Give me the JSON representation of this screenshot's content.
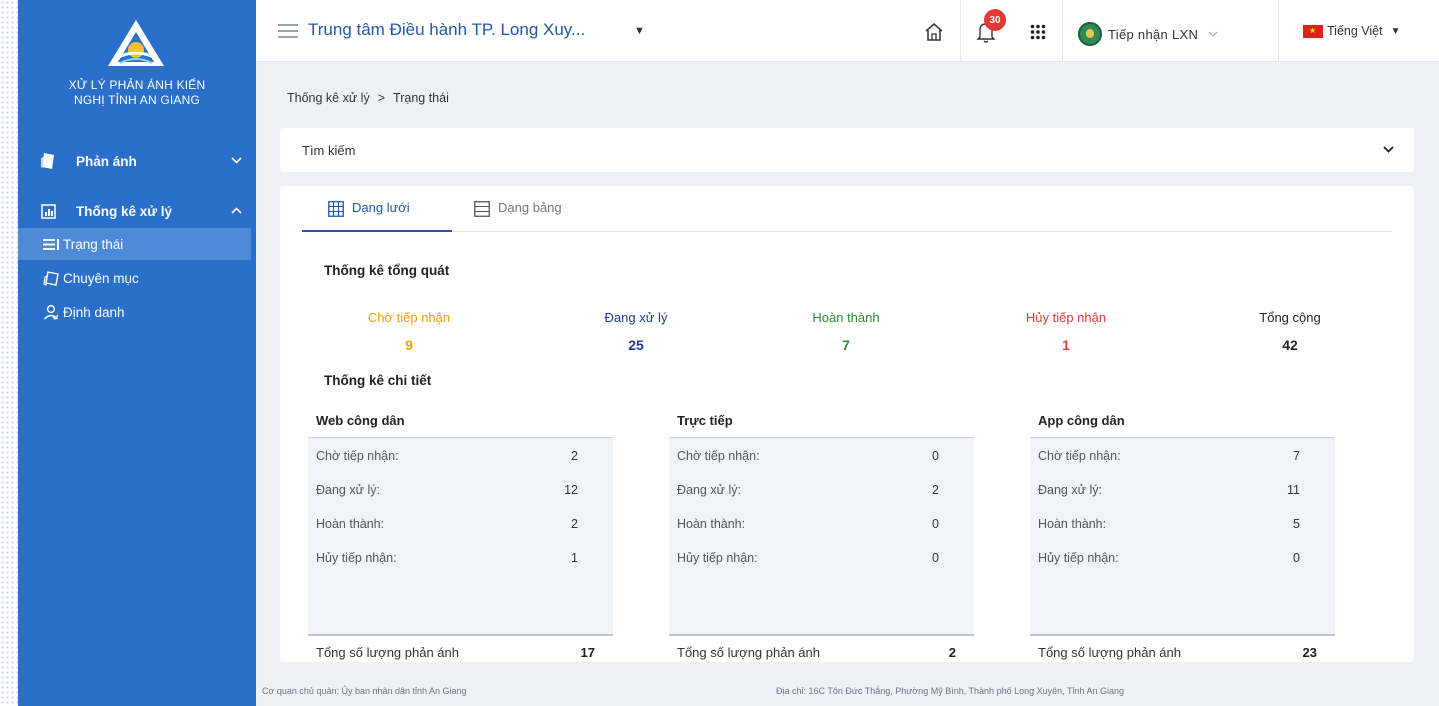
{
  "sidebar": {
    "brand_line1": "XỬ LÝ PHẢN ÁNH KIẾN",
    "brand_line2": "NGHỊ TỈNH AN GIANG",
    "groups": [
      {
        "label": "Phản ánh",
        "icon": "document-icon",
        "expanded": false
      },
      {
        "label": "Thống kê xử lý",
        "icon": "chart-icon",
        "expanded": true
      }
    ],
    "items": [
      {
        "label": "Trạng thái",
        "icon": "list-icon",
        "active": true
      },
      {
        "label": "Chuyên mục",
        "icon": "folder-icon",
        "active": false
      },
      {
        "label": "Định danh",
        "icon": "user-icon",
        "active": false
      }
    ]
  },
  "topbar": {
    "title": "Trung tâm Điều hành TP. Long Xuy...",
    "notification_count": "30",
    "user_name": "Tiếp nhận LXN",
    "language": "Tiếng Việt"
  },
  "breadcrumb": {
    "parent": "Thống kê xử lý",
    "separator": ">",
    "current": "Trạng thái"
  },
  "search": {
    "label": "Tìm kiếm"
  },
  "tabs": [
    {
      "label": "Dạng lưới",
      "active": true,
      "icon": "grid-icon"
    },
    {
      "label": "Dạng bảng",
      "active": false,
      "icon": "table-icon"
    }
  ],
  "summary": {
    "title": "Thống kê tổng quát",
    "columns": [
      {
        "label": "Chờ tiếp nhận",
        "value": "9",
        "color": "#f0a000"
      },
      {
        "label": "Đang xử lý",
        "value": "25",
        "color": "#1f3a93"
      },
      {
        "label": "Hoàn thành",
        "value": "7",
        "color": "#2e8b2e"
      },
      {
        "label": "Hủy tiếp nhận",
        "value": "1",
        "color": "#e53935"
      },
      {
        "label": "Tổng cộng",
        "value": "42",
        "color": "#222222"
      }
    ]
  },
  "detail": {
    "title": "Thống kê chi tiết",
    "cards": [
      {
        "title": "Web công dân",
        "rows": [
          {
            "label": "Chờ tiếp nhận:",
            "value": "2"
          },
          {
            "label": "Đang xử lý:",
            "value": "12"
          },
          {
            "label": "Hoàn thành:",
            "value": "2"
          },
          {
            "label": "Hủy tiếp nhận:",
            "value": "1"
          }
        ],
        "total_label": "Tổng số lượng phản ánh",
        "total": "17"
      },
      {
        "title": "Trực tiếp",
        "rows": [
          {
            "label": "Chờ tiếp nhận:",
            "value": "0"
          },
          {
            "label": "Đang xử lý:",
            "value": "2"
          },
          {
            "label": "Hoàn thành:",
            "value": "0"
          },
          {
            "label": "Hủy tiếp nhận:",
            "value": "0"
          }
        ],
        "total_label": "Tổng số lượng phản ánh",
        "total": "2"
      },
      {
        "title": "App công dân",
        "rows": [
          {
            "label": "Chờ tiếp nhận:",
            "value": "7"
          },
          {
            "label": "Đang xử lý:",
            "value": "11"
          },
          {
            "label": "Hoàn thành:",
            "value": "5"
          },
          {
            "label": "Hủy tiếp nhận:",
            "value": "0"
          }
        ],
        "total_label": "Tổng số lượng phản ánh",
        "total": "23"
      }
    ]
  },
  "footer": {
    "left": "Cơ quan chủ quản: Ủy ban nhân dân tỉnh An Giang",
    "right": "Địa chỉ: 16C Tôn Đức Thắng, Phường Mỹ Bình, Thành phố Long Xuyên, Tỉnh An Giang"
  }
}
